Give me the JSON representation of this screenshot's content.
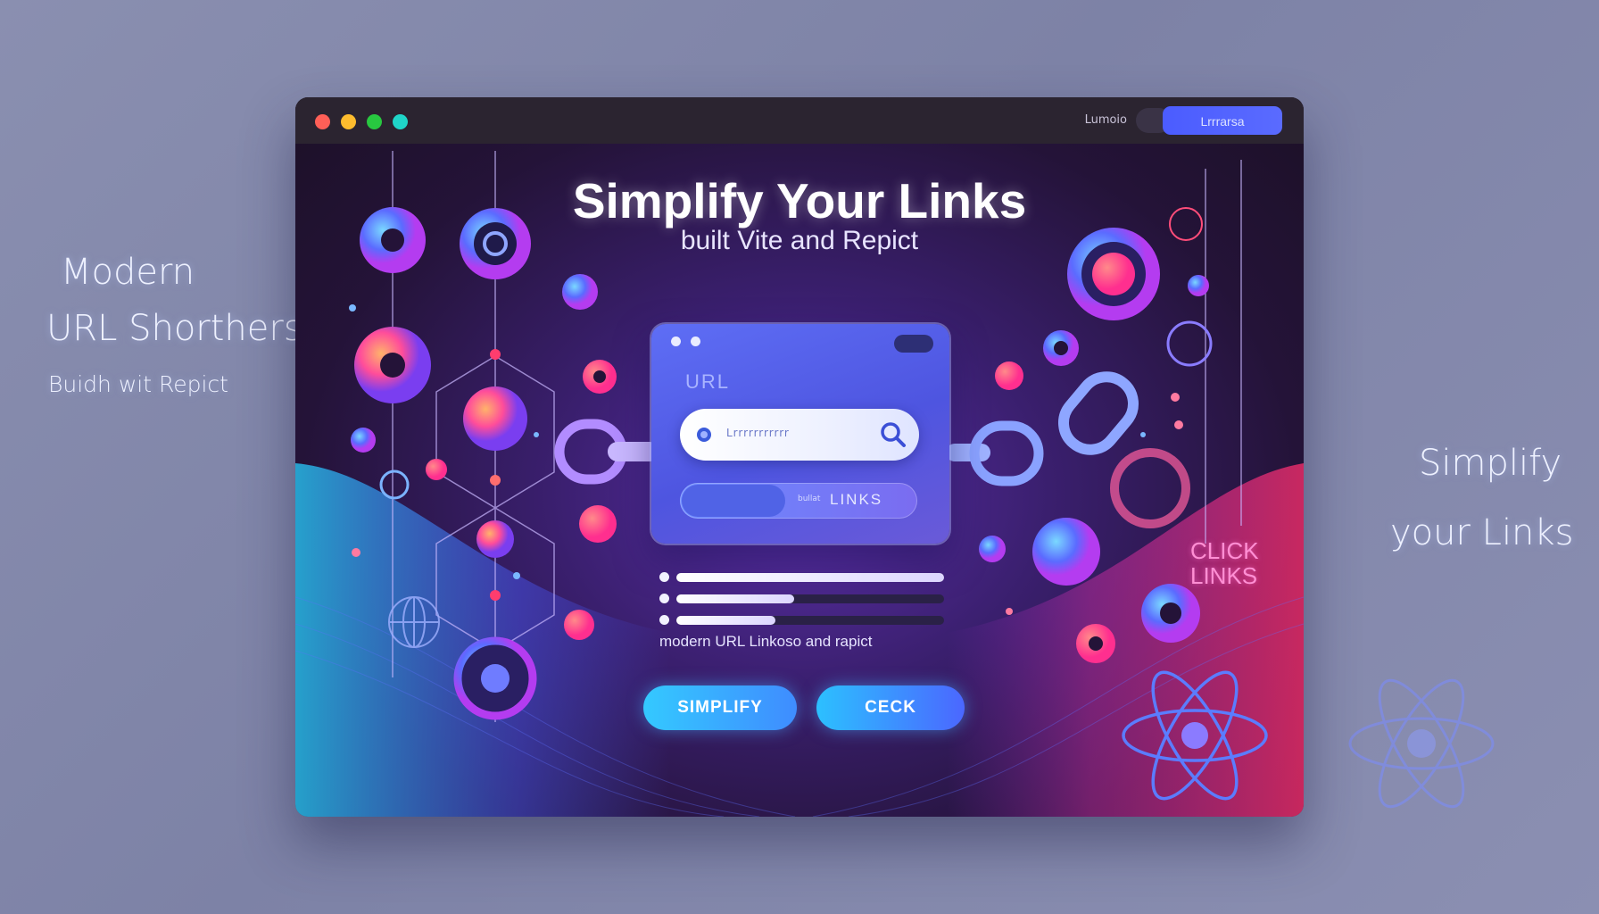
{
  "side_text": {
    "left_line1": "Modern",
    "left_line2": "URL Shorthers",
    "left_line3": "Buidh wit Repict",
    "right_line1": "Simplify",
    "right_line2": "your Links"
  },
  "window": {
    "titlebar": {
      "dots": [
        "#ff5f57",
        "#febc2e",
        "#28c840",
        "#1fd5c8"
      ],
      "small_text": "Lumoio",
      "button_label": "Lrrrarsa"
    },
    "headline": "Simplify Your Links",
    "subline": "built Vite and Repict",
    "card": {
      "label": "URL",
      "search_value": "Lrrrrrrrrrrr",
      "links_prefix": "bullat",
      "links_text": "LINKS"
    },
    "progress": [
      {
        "label": "bar-1",
        "fraction": 1.0
      },
      {
        "label": "bar-2",
        "fraction": 0.44
      },
      {
        "label": "bar-3",
        "fraction": 0.37
      }
    ],
    "caption": "modern URL Linkoso and rapict",
    "buttons": {
      "simplify": "SIMPLIFY",
      "check": "CECK"
    },
    "click_links": "CLICK LINKS"
  },
  "colors": {
    "accent_blue": "#3f8cff",
    "accent_pink": "#ff3d8d",
    "accent_purple": "#7a3ef0"
  },
  "icons": [
    "search-icon",
    "chain-link-icon",
    "react-atom-icon",
    "globe-icon",
    "target-icon"
  ]
}
